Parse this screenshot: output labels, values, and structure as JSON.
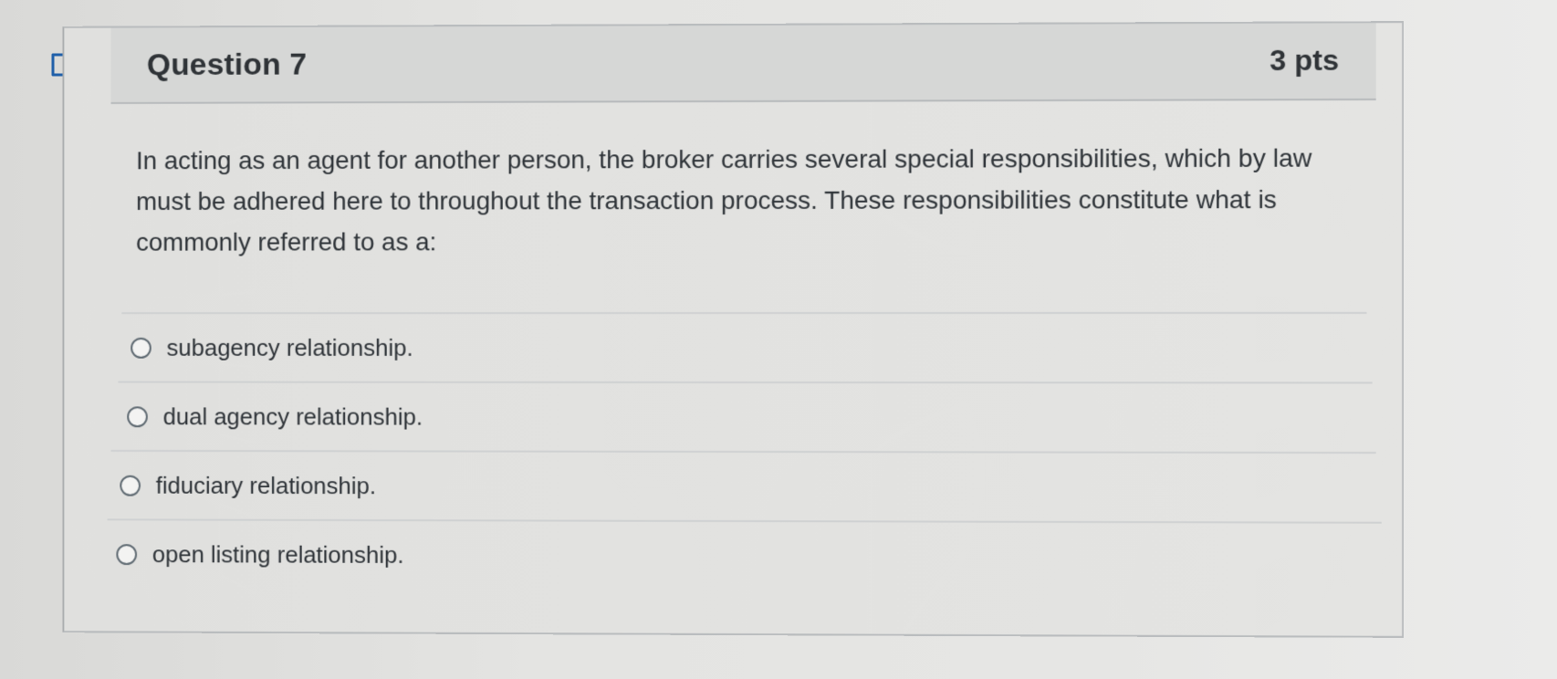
{
  "question": {
    "title": "Question 7",
    "points": "3 pts",
    "text": "In acting as an agent for another person, the broker carries several special responsibilities, which by law must be adhered here to throughout the transaction process. These responsibilities constitute what is commonly referred to as a:"
  },
  "answers": [
    {
      "label": "subagency relationship."
    },
    {
      "label": "dual agency relationship."
    },
    {
      "label": "fiduciary relationship."
    },
    {
      "label": "open listing relationship."
    }
  ],
  "icons": {
    "flag": "flag-icon",
    "radio": "radio-icon"
  },
  "colors": {
    "header_background": "#d6d7d6",
    "page_background": "#e4e4e2",
    "text": "#2f3439",
    "border": "#b9bcbe"
  }
}
